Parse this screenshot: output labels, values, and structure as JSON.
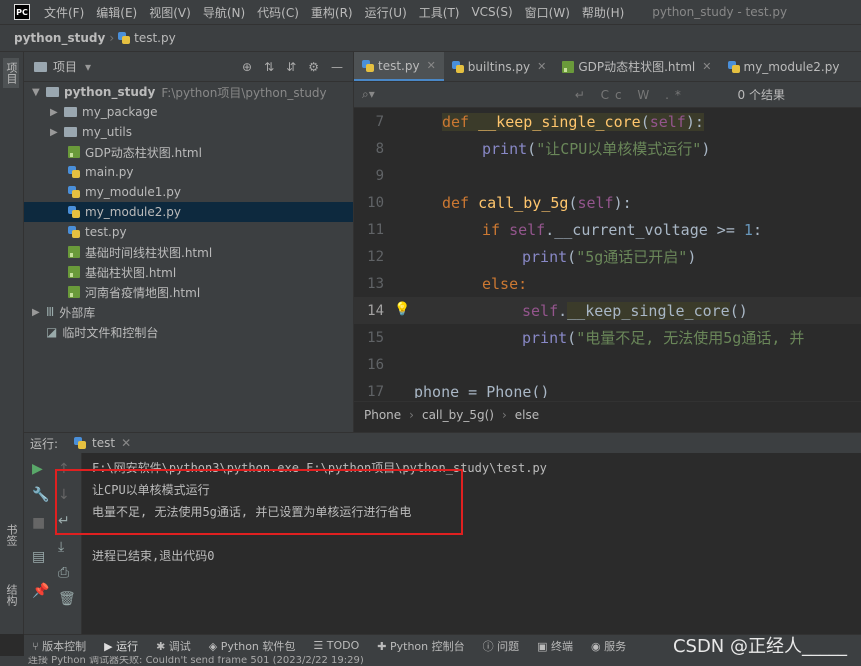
{
  "menubar": {
    "logo": "PC",
    "items": [
      "文件(F)",
      "编辑(E)",
      "视图(V)",
      "导航(N)",
      "代码(C)",
      "重构(R)",
      "运行(U)",
      "工具(T)",
      "VCS(S)",
      "窗口(W)",
      "帮助(H)"
    ],
    "window_title": "python_study - test.py"
  },
  "navbar": {
    "project": "python_study",
    "file": "test.py"
  },
  "left_strip": {
    "project_label": "项目",
    "bookmarks_label": "书签",
    "structure_label": "结构"
  },
  "project_panel": {
    "title": "项目",
    "root": {
      "name": "python_study",
      "path": "F:\\python项目\\python_study"
    },
    "items": [
      {
        "name": "my_package",
        "type": "folder"
      },
      {
        "name": "my_utils",
        "type": "folder"
      },
      {
        "name": "GDP动态柱状图.html",
        "type": "html"
      },
      {
        "name": "main.py",
        "type": "py"
      },
      {
        "name": "my_module1.py",
        "type": "py"
      },
      {
        "name": "my_module2.py",
        "type": "py"
      },
      {
        "name": "test.py",
        "type": "py"
      },
      {
        "name": "基础时间线柱状图.html",
        "type": "html"
      },
      {
        "name": "基础柱状图.html",
        "type": "html"
      },
      {
        "name": "河南省疫情地图.html",
        "type": "html"
      }
    ],
    "external_libs": "外部库",
    "scratches": "临时文件和控制台"
  },
  "editor": {
    "tabs": [
      "test.py",
      "builtins.py",
      "GDP动态柱状图.html",
      "my_module2.py"
    ],
    "active_tab": "test.py",
    "search_results": "0 个结果",
    "lines": [
      "7",
      "8",
      "9",
      "10",
      "11",
      "12",
      "13",
      "14",
      "15",
      "16",
      "17"
    ],
    "code": {
      "l7": {
        "kw": "def",
        "fn": "__keep_single_core",
        "p1": "(",
        "self": "self",
        "p2": "):"
      },
      "l8": {
        "fn": "print",
        "p1": "(",
        "str": "\"让CPU以单核模式运行\"",
        "p2": ")"
      },
      "l10": {
        "kw": "def",
        "fn": "call_by_5g",
        "p1": "(",
        "self": "self",
        "p2": "):"
      },
      "l11": {
        "kw": "if",
        "self": "self",
        ".attr": ".__current_voltage >= ",
        "num": "1",
        ":": ":"
      },
      "l12": {
        "fn": "print",
        "p1": "(",
        "str": "\"5g通话已开启\"",
        "p2": ")"
      },
      "l13": {
        "kw": "else:"
      },
      "l14": {
        "self": "self",
        "dot": ".",
        "fn": "__keep_single_core",
        "p": "()"
      },
      "l15": {
        "fn": "print",
        "p1": "(",
        "str": "\"电量不足, 无法使用5g通话, 并"
      },
      "l17": {
        "var": "phone = Phone()"
      }
    },
    "breadcrumbs": [
      "Phone",
      "call_by_5g()",
      "else"
    ]
  },
  "run_panel": {
    "label": "运行:",
    "tab": "test",
    "console": [
      "F:\\网安软件\\python3\\python.exe F:\\python项目\\python_study\\test.py",
      "让CPU以单核模式运行",
      "电量不足, 无法使用5g通话, 并已设置为单核运行进行省电",
      "",
      "进程已结束,退出代码0"
    ]
  },
  "bottom_tabs": [
    "版本控制",
    "运行",
    "调试",
    "Python 软件包",
    "TODO",
    "Python 控制台",
    "问题",
    "终端",
    "服务"
  ],
  "active_bottom_tab": "运行",
  "watermark": "CSDN @正经人_____",
  "status": "连接 Python 调试器失败: Couldn't send frame 501 (2023/2/22 19:29)"
}
